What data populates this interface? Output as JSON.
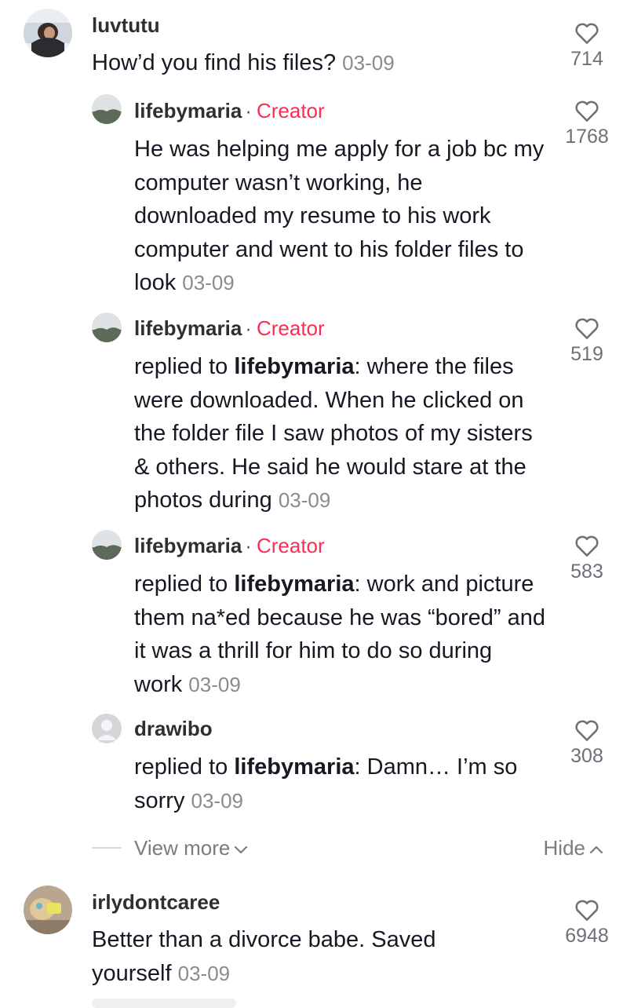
{
  "comments": [
    {
      "username": "luvtutu",
      "text": "How’d you find his files?",
      "timestamp": "03-09",
      "likes": "714"
    },
    {
      "username": "lifebymaria",
      "badge": "Creator",
      "text": "He was helping me apply for a job bc my computer wasn’t working, he downloaded my resume to his work computer and went to his folder files to look",
      "timestamp": "03-09",
      "likes": "1768"
    },
    {
      "username": "lifebymaria",
      "badge": "Creator",
      "reply_prefix": "replied to",
      "reply_to": "lifebymaria",
      "text": "where the files were downloaded. When he clicked on the folder file I saw photos of my sisters & others. He said he would stare at the photos during",
      "timestamp": "03-09",
      "likes": "519"
    },
    {
      "username": "lifebymaria",
      "badge": "Creator",
      "reply_prefix": "replied to",
      "reply_to": "lifebymaria",
      "text": "work and picture them na*ed because he was “bored” and it was a thrill for him to do so during work",
      "timestamp": "03-09",
      "likes": "583"
    },
    {
      "username": "drawibo",
      "reply_prefix": "replied to",
      "reply_to": "lifebymaria",
      "text": "Damn… I’m so sorry",
      "timestamp": "03-09",
      "likes": "308"
    },
    {
      "username": "irlydontcaree",
      "text": "Better than a divorce babe. Saved yourself",
      "timestamp": "03-09",
      "likes": "6948"
    }
  ],
  "thread_controls": {
    "view_more": "View more",
    "hide": "Hide"
  },
  "colors": {
    "creator_badge": "#fe2c55",
    "timestamp": "#8a8b91",
    "text": "#161823"
  },
  "icons": {
    "like": "heart-outline-icon",
    "view_more": "chevron-down-icon",
    "hide": "chevron-up-icon"
  }
}
